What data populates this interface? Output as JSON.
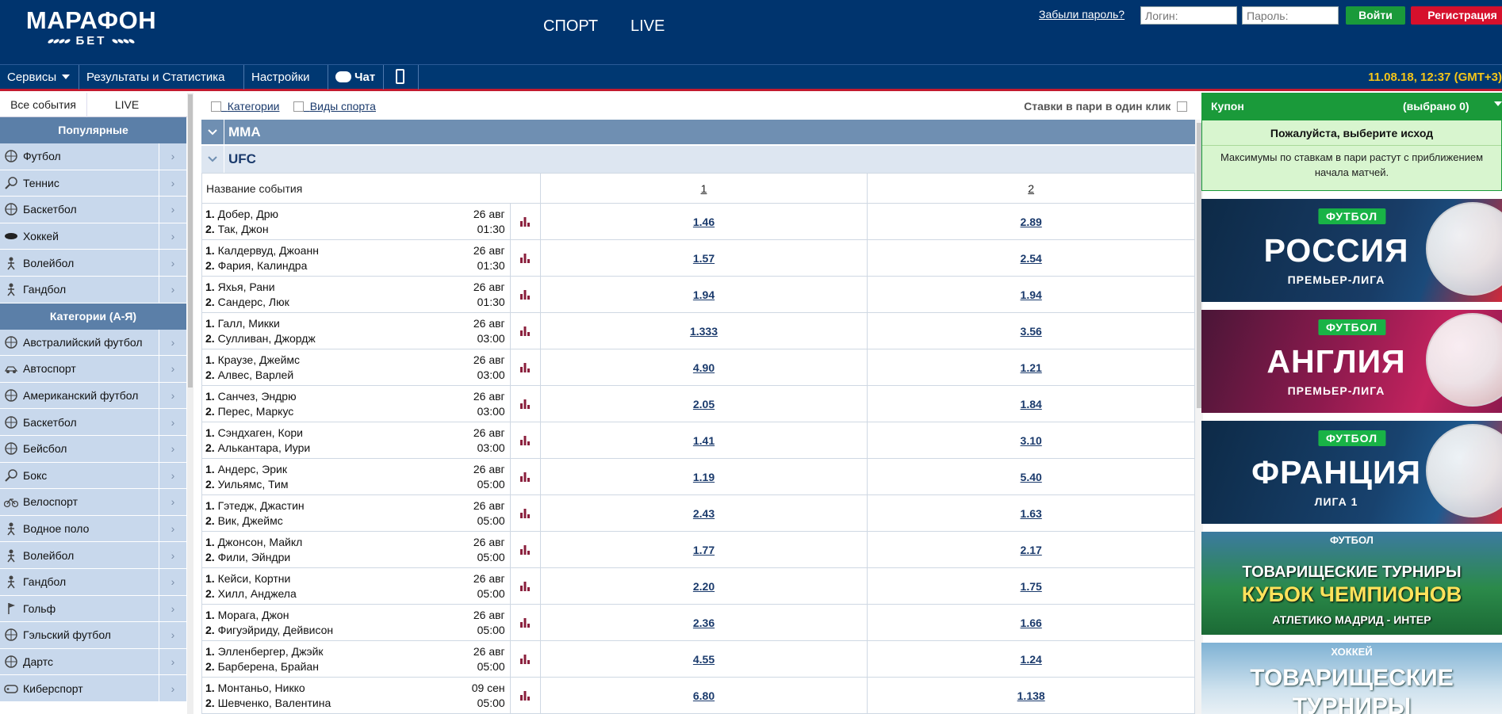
{
  "header": {
    "logo_main": "МАРАФОН",
    "logo_sub": "БЕТ",
    "nav_sport": "СПОРТ",
    "nav_live": "LIVE",
    "forgot_password": "Забыли пароль?",
    "login_placeholder": "Логин:",
    "password_placeholder": "Пароль:",
    "login_button": "Войти",
    "register_button": "Регистрация"
  },
  "menu": {
    "services": "Сервисы",
    "results": "Результаты и Статистика",
    "settings": "Настройки",
    "chat": "Чат",
    "datetime": "11.08.18, 12:37 (GMT+3)"
  },
  "sidebar": {
    "tab_all": "Все события",
    "tab_live": "LIVE",
    "popular_title": "Популярные",
    "popular": [
      {
        "label": "Футбол",
        "icon": "soccer-ball-icon"
      },
      {
        "label": "Теннис",
        "icon": "tennis-racket-icon"
      },
      {
        "label": "Баскетбол",
        "icon": "basketball-icon"
      },
      {
        "label": "Хоккей",
        "icon": "hockey-puck-icon"
      },
      {
        "label": "Волейбол",
        "icon": "volleyball-player-icon"
      },
      {
        "label": "Гандбол",
        "icon": "handball-icon"
      }
    ],
    "categories_title": "Категории (А-Я)",
    "categories": [
      {
        "label": "Австралийский футбол",
        "icon": "australian-football-icon"
      },
      {
        "label": "Автоспорт",
        "icon": "motorsport-icon"
      },
      {
        "label": "Американский футбол",
        "icon": "american-football-icon"
      },
      {
        "label": "Баскетбол",
        "icon": "basketball-icon"
      },
      {
        "label": "Бейсбол",
        "icon": "baseball-icon"
      },
      {
        "label": "Бокс",
        "icon": "boxing-glove-icon"
      },
      {
        "label": "Велоспорт",
        "icon": "bicycle-icon"
      },
      {
        "label": "Водное поло",
        "icon": "water-polo-icon"
      },
      {
        "label": "Волейбол",
        "icon": "volleyball-player-icon"
      },
      {
        "label": "Гандбол",
        "icon": "handball-icon"
      },
      {
        "label": "Гольф",
        "icon": "golf-flag-icon"
      },
      {
        "label": "Гэльский футбол",
        "icon": "gaelic-football-icon"
      },
      {
        "label": "Дартс",
        "icon": "darts-icon"
      },
      {
        "label": "Киберспорт",
        "icon": "gamepad-icon"
      }
    ]
  },
  "main": {
    "filter_categories": "Категории",
    "filter_sports": "Виды спорта",
    "one_click": "Ставки в пари в один клик",
    "group_title": "MMA",
    "subgroup_title": "UFC",
    "col_event": "Название события",
    "col_1": "1",
    "col_2": "2",
    "events": [
      {
        "p1": "Добер, Дрю",
        "p2": "Так, Джон",
        "date": "26 авг",
        "time": "01:30",
        "o1": "1.46",
        "o2": "2.89"
      },
      {
        "p1": "Калдервуд, Джоанн",
        "p2": "Фария, Калиндра",
        "date": "26 авг",
        "time": "01:30",
        "o1": "1.57",
        "o2": "2.54"
      },
      {
        "p1": "Яхья, Рани",
        "p2": "Сандерс, Люк",
        "date": "26 авг",
        "time": "01:30",
        "o1": "1.94",
        "o2": "1.94"
      },
      {
        "p1": "Галл, Микки",
        "p2": "Сулливан, Джордж",
        "date": "26 авг",
        "time": "03:00",
        "o1": "1.333",
        "o2": "3.56"
      },
      {
        "p1": "Краузе, Джеймс",
        "p2": "Алвес, Варлей",
        "date": "26 авг",
        "time": "03:00",
        "o1": "4.90",
        "o2": "1.21"
      },
      {
        "p1": "Санчез, Эндрю",
        "p2": "Перес, Маркус",
        "date": "26 авг",
        "time": "03:00",
        "o1": "2.05",
        "o2": "1.84"
      },
      {
        "p1": "Сэндхаген, Кори",
        "p2": "Алькантара, Иури",
        "date": "26 авг",
        "time": "03:00",
        "o1": "1.41",
        "o2": "3.10"
      },
      {
        "p1": "Андерс, Эрик",
        "p2": "Уильямс, Тим",
        "date": "26 авг",
        "time": "05:00",
        "o1": "1.19",
        "o2": "5.40"
      },
      {
        "p1": "Гэтедж, Джастин",
        "p2": "Вик, Джеймс",
        "date": "26 авг",
        "time": "05:00",
        "o1": "2.43",
        "o2": "1.63"
      },
      {
        "p1": "Джонсон, Майкл",
        "p2": "Фили, Эйндри",
        "date": "26 авг",
        "time": "05:00",
        "o1": "1.77",
        "o2": "2.17"
      },
      {
        "p1": "Кейси, Кортни",
        "p2": "Хилл, Анджела",
        "date": "26 авг",
        "time": "05:00",
        "o1": "2.20",
        "o2": "1.75"
      },
      {
        "p1": "Морага, Джон",
        "p2": "Фигуэйриду, Дейвисон",
        "date": "26 авг",
        "time": "05:00",
        "o1": "2.36",
        "o2": "1.66"
      },
      {
        "p1": "Элленбергер, Джэйк",
        "p2": "Барберена, Брайан",
        "date": "26 авг",
        "time": "05:00",
        "o1": "4.55",
        "o2": "1.24"
      },
      {
        "p1": "Монтаньо, Никко",
        "p2": "Шевченко, Валентина",
        "date": "09 сен",
        "time": "05:00",
        "o1": "6.80",
        "o2": "1.138"
      }
    ]
  },
  "coupon": {
    "title": "Купон",
    "count": "(выбрано 0)",
    "select_prompt": "Пожалуйста, выберите исход",
    "note": "Максимумы по ставкам в пари растут с приближением начала матчей."
  },
  "banners": [
    {
      "badge": "ФУТБОЛ",
      "big": "РОССИЯ",
      "small": "ПРЕМЬЕР-ЛИГА"
    },
    {
      "badge": "ФУТБОЛ",
      "big": "АНГЛИЯ",
      "small": "ПРЕМЬЕР-ЛИГА"
    },
    {
      "badge": "ФУТБОЛ",
      "big": "ФРАНЦИЯ",
      "small": "ЛИГА 1"
    },
    {
      "top": "ФУТБОЛ",
      "mid": "ТОВАРИЩЕСКИЕ ТУРНИРЫ",
      "big": "КУБОК ЧЕМПИОНОВ",
      "bot": "АТЛЕТИКО МАДРИД - ИНТЕР"
    },
    {
      "top": "ХОККЕЙ",
      "mid": "ТОВАРИЩЕСКИЕ",
      "big": "ТУРНИРЫ"
    }
  ],
  "colors": {
    "header_bg": "#00346e",
    "accent_red": "#c21a2f",
    "login_green": "#1a9a3a",
    "register_red": "#d6102c",
    "datetime_yellow": "#f5c518",
    "sidebar_item_bg": "#c8d8ec",
    "group_head_bg": "#6f8fb2"
  }
}
